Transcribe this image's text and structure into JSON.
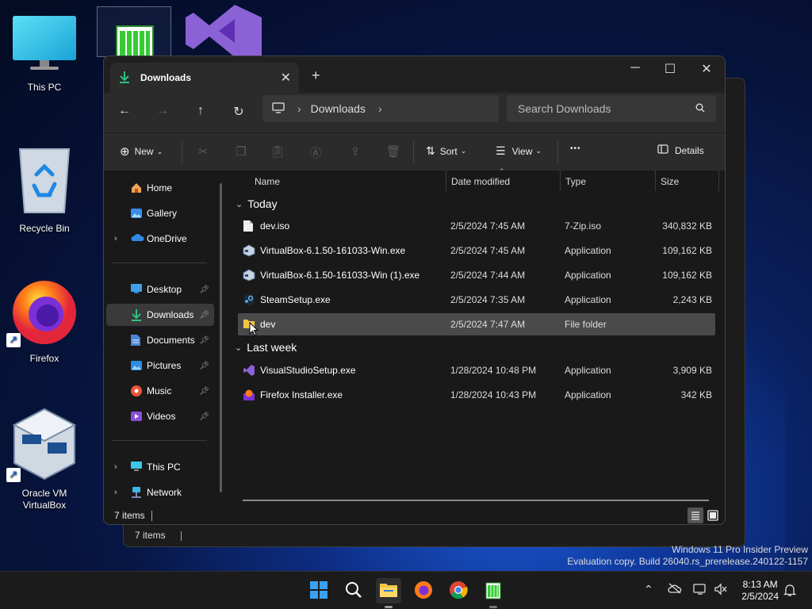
{
  "desktop": {
    "icons": [
      {
        "label": "This PC"
      },
      {
        "label": "Recycle Bin"
      },
      {
        "label": "Firefox"
      },
      {
        "label": "Oracle VM VirtualBox"
      }
    ]
  },
  "ghost_window": {
    "status_items": "7 items"
  },
  "window": {
    "tab_title": "Downloads",
    "new_tab": "+",
    "address": {
      "segment": "Downloads"
    },
    "search": {
      "placeholder": "Search Downloads"
    },
    "toolbar": {
      "new_label": "New",
      "sort_label": "Sort",
      "view_label": "View",
      "more_label": "•••",
      "details_label": "Details"
    },
    "sidebar": {
      "items": [
        {
          "label": "Home"
        },
        {
          "label": "Gallery"
        },
        {
          "label": "OneDrive"
        },
        {
          "label": "Desktop"
        },
        {
          "label": "Downloads"
        },
        {
          "label": "Documents"
        },
        {
          "label": "Pictures"
        },
        {
          "label": "Music"
        },
        {
          "label": "Videos"
        },
        {
          "label": "This PC"
        },
        {
          "label": "Network"
        }
      ]
    },
    "columns": {
      "name": "Name",
      "date": "Date modified",
      "type": "Type",
      "size": "Size"
    },
    "groups": [
      {
        "label": "Today",
        "rows": [
          {
            "name": "dev.iso",
            "date": "2/5/2024 7:45 AM",
            "type": "7-Zip.iso",
            "size": "340,832 KB"
          },
          {
            "name": "VirtualBox-6.1.50-161033-Win.exe",
            "date": "2/5/2024 7:45 AM",
            "type": "Application",
            "size": "109,162 KB"
          },
          {
            "name": "VirtualBox-6.1.50-161033-Win (1).exe",
            "date": "2/5/2024 7:44 AM",
            "type": "Application",
            "size": "109,162 KB"
          },
          {
            "name": "SteamSetup.exe",
            "date": "2/5/2024 7:35 AM",
            "type": "Application",
            "size": "2,243 KB"
          },
          {
            "name": "dev",
            "date": "2/5/2024 7:47 AM",
            "type": "File folder",
            "size": ""
          }
        ]
      },
      {
        "label": "Last week",
        "rows": [
          {
            "name": "VisualStudioSetup.exe",
            "date": "1/28/2024 10:48 PM",
            "type": "Application",
            "size": "3,909 KB"
          },
          {
            "name": "Firefox Installer.exe",
            "date": "1/28/2024 10:43 PM",
            "type": "Application",
            "size": "342 KB"
          }
        ]
      }
    ],
    "status": {
      "items": "7 items"
    }
  },
  "watermark": {
    "line1": "Windows 11 Pro Insider Preview",
    "line2": "Evaluation copy. Build 26040.rs_prerelease.240122-1157"
  },
  "taskbar": {
    "time": "8:13 AM",
    "date": "2/5/2024"
  },
  "colors": {
    "accent": "#0078d4",
    "folder": "#f5c542",
    "window_bg": "#191919"
  }
}
